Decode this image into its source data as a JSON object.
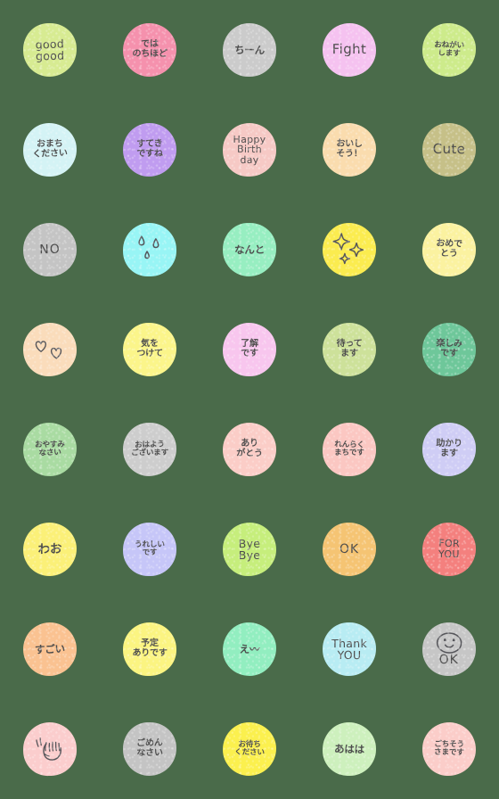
{
  "sheet": {
    "title": "Handwritten Japanese Message Emoji Sheet",
    "background_color": "#4a6b4a",
    "columns": 5,
    "rows": 8,
    "text_color": "#4d4d4d"
  },
  "emojis": [
    {
      "id": "good-good",
      "line1": "good",
      "line2": "good",
      "color": "#d7eb92",
      "style": "s-lat2",
      "kind": "text"
    },
    {
      "id": "dewa-nochihodo",
      "line1": "では",
      "line2": "のちほど",
      "color": "#f591ad",
      "style": "s-jp2",
      "kind": "text"
    },
    {
      "id": "chiin",
      "line1": "ちーん",
      "line2": "",
      "color": "#cbcbcb",
      "style": "s-jp1",
      "kind": "text"
    },
    {
      "id": "fight",
      "line1": "Fight",
      "line2": "",
      "color": "#f5c2f0",
      "style": "s-lat1",
      "kind": "text"
    },
    {
      "id": "onegaishimasu",
      "line1": "おねがい",
      "line2": "します",
      "color": "#cdeb8b",
      "style": "s-jp3",
      "kind": "text"
    },
    {
      "id": "omachi-kudasai",
      "line1": "おまち",
      "line2": "ください",
      "color": "#d4f3f5",
      "style": "s-jp2",
      "kind": "text"
    },
    {
      "id": "suteki-desune",
      "line1": "すてき",
      "line2": "ですね",
      "color": "#c09cf0",
      "style": "s-jp2",
      "kind": "text"
    },
    {
      "id": "happy-birthday",
      "line1": "Happy",
      "line2": "Birth",
      "line3": "day",
      "color": "#f6c9c5",
      "style": "s-lat3",
      "kind": "text3"
    },
    {
      "id": "oishisou",
      "line1": "おいし",
      "line2": "そう！",
      "color": "#fadcae",
      "style": "s-jp2",
      "kind": "text"
    },
    {
      "id": "cute",
      "line1": "Cute",
      "line2": "",
      "color": "#c6c088",
      "style": "s-lat1",
      "kind": "text"
    },
    {
      "id": "no",
      "line1": "NO",
      "line2": "",
      "color": "#c4c4c4",
      "style": "s-num",
      "kind": "text"
    },
    {
      "id": "sweat-drops",
      "line1": "",
      "line2": "",
      "color": "#98f5f5",
      "style": "",
      "kind": "drops"
    },
    {
      "id": "nanto",
      "line1": "なんと",
      "line2": "",
      "color": "#97eec1",
      "style": "s-jp1",
      "kind": "text"
    },
    {
      "id": "sparkles",
      "line1": "",
      "line2": "",
      "color": "#fbec4f",
      "style": "",
      "kind": "sparkles"
    },
    {
      "id": "omedetou",
      "line1": "おめで",
      "line2": "とう",
      "color": "#fbf2a0",
      "style": "s-jp2",
      "kind": "text"
    },
    {
      "id": "hearts",
      "line1": "",
      "line2": "",
      "color": "#fadcbb",
      "style": "",
      "kind": "hearts"
    },
    {
      "id": "ki-wo-tsukete",
      "line1": "気を",
      "line2": "つけて",
      "color": "#fbf58a",
      "style": "s-jp2",
      "kind": "text"
    },
    {
      "id": "ryoukai-desu",
      "line1": "了解",
      "line2": "です",
      "color": "#f8c6ee",
      "style": "s-jp2",
      "kind": "text"
    },
    {
      "id": "mattemasu",
      "line1": "待って",
      "line2": "ます",
      "color": "#cde19a",
      "style": "s-jp2",
      "kind": "text"
    },
    {
      "id": "tanoshimi-desu",
      "line1": "楽しみ",
      "line2": "です",
      "color": "#6ec79a",
      "style": "s-jp2",
      "kind": "text"
    },
    {
      "id": "oyasuminasai",
      "line1": "おやすみ",
      "line2": "なさい",
      "color": "#a9dba2",
      "style": "s-jp3",
      "kind": "text"
    },
    {
      "id": "ohayou-gozaimasu",
      "line1": "おはよう",
      "line2": "ございます",
      "color": "#cdcdcd",
      "style": "s-jp3",
      "kind": "text"
    },
    {
      "id": "arigatou",
      "line1": "あり",
      "line2": "がとう",
      "color": "#fbcdc7",
      "style": "s-jp2",
      "kind": "text"
    },
    {
      "id": "renraku-machi",
      "line1": "れんらく",
      "line2": "まちです",
      "color": "#fbc7c2",
      "style": "s-jp3",
      "kind": "text"
    },
    {
      "id": "tasukarimasu",
      "line1": "助かり",
      "line2": "ます",
      "color": "#cfcdf5",
      "style": "s-jp2",
      "kind": "text"
    },
    {
      "id": "waa",
      "line1": "わお",
      "line2": "",
      "color": "#fbf078",
      "style": "s-jp4",
      "kind": "text"
    },
    {
      "id": "ureshii-desu",
      "line1": "うれしい",
      "line2": "です",
      "color": "#c6c6f8",
      "style": "s-jp3",
      "kind": "text"
    },
    {
      "id": "bye-bye",
      "line1": "Bye",
      "line2": "Bye",
      "color": "#c6ee7c",
      "style": "s-lat2",
      "kind": "text"
    },
    {
      "id": "ok-orange",
      "line1": "OK",
      "line2": "",
      "color": "#f5c473",
      "style": "s-num",
      "kind": "text"
    },
    {
      "id": "for-you",
      "line1": "FOR",
      "line2": "YOU",
      "color": "#f4807e",
      "style": "s-lat3",
      "kind": "text"
    },
    {
      "id": "sugoi",
      "line1": "すごい",
      "line2": "",
      "color": "#fac291",
      "style": "s-jp1",
      "kind": "text"
    },
    {
      "id": "yotei-aridesu",
      "line1": "予定",
      "line2": "ありです",
      "color": "#fbf481",
      "style": "s-jp2",
      "kind": "text"
    },
    {
      "id": "ee-tilde",
      "line1": "え〰",
      "line2": "",
      "color": "#92eec0",
      "style": "s-jp1",
      "kind": "text"
    },
    {
      "id": "thank-you",
      "line1": "Thank",
      "line2": "YOU",
      "color": "#b8ecf3",
      "style": "s-lat2",
      "kind": "text"
    },
    {
      "id": "smiley-ok",
      "line1": "OK",
      "line2": "",
      "color": "#c6c6c6",
      "style": "",
      "kind": "smiley_ok"
    },
    {
      "id": "clapping-hands",
      "line1": "",
      "line2": "",
      "color": "#fbcdcd",
      "style": "",
      "kind": "clap"
    },
    {
      "id": "gomennasai",
      "line1": "ごめん",
      "line2": "なさい",
      "color": "#c4c4c4",
      "style": "s-jp2",
      "kind": "text"
    },
    {
      "id": "omachi-kudasai-2",
      "line1": "お待ち",
      "line2": "ください",
      "color": "#fbf04e",
      "style": "s-jp3",
      "kind": "text"
    },
    {
      "id": "ahaha",
      "line1": "あはは",
      "line2": "",
      "color": "#cdf0bd",
      "style": "s-jp1",
      "kind": "text"
    },
    {
      "id": "gochisousama",
      "line1": "ごちそう",
      "line2": "さまです",
      "color": "#fbcdc9",
      "style": "s-jp3",
      "kind": "text"
    }
  ]
}
